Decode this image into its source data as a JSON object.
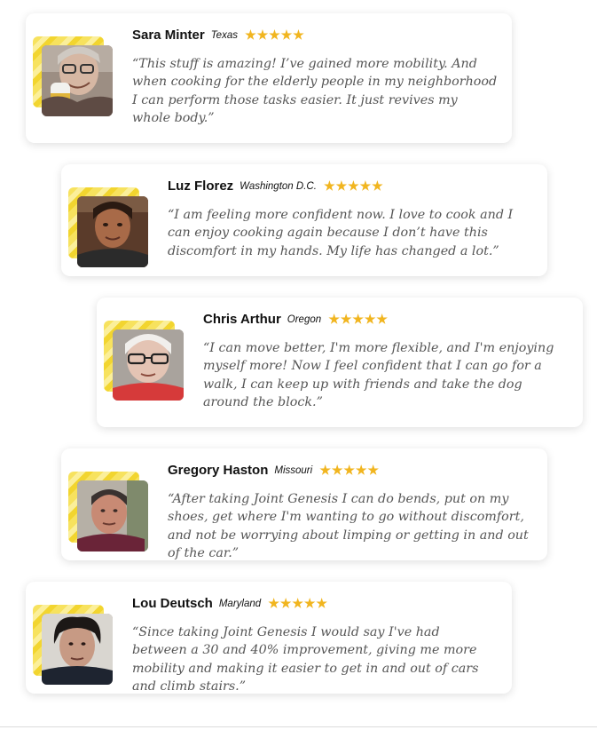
{
  "testimonials": [
    {
      "name": "Sara Minter",
      "location": "Texas",
      "rating": 5,
      "quote": "“This stuff is amazing! I’ve gained more mobility. And when cooking for the elderly people in my neighborhood I can perform those tasks easier. It just revives my whole body.”"
    },
    {
      "name": "Luz Florez",
      "location": "Washington D.C.",
      "rating": 5,
      "quote": "“I am feeling more confident now. I love to cook and I can enjoy cooking again because I don’t have this discomfort in my hands. My life has changed a lot.”"
    },
    {
      "name": "Chris Arthur",
      "location": "Oregon",
      "rating": 5,
      "quote": "“I can move better, I'm more flexible, and I'm enjoying myself more! Now I feel confident that I can go for a walk, I can keep up with friends and take the dog around the block.”"
    },
    {
      "name": "Gregory Haston",
      "location": "Missouri",
      "rating": 5,
      "quote": "“After taking Joint Genesis I can do bends, put on my shoes, get where I'm wanting to go without discomfort, and not be worrying about limping or getting in and out of the car.”"
    },
    {
      "name": "Lou Deutsch",
      "location": "Maryland",
      "rating": 5,
      "quote": "“Since taking Joint Genesis I would say I've had between a 30 and 40% improvement, giving me more mobility and making it easier to get in and out of cars and climb stairs.”"
    }
  ],
  "colors": {
    "star": "#f1b51f",
    "photo_accent": "#f7e25e",
    "quote_text": "#565656",
    "name_text": "#111111"
  }
}
